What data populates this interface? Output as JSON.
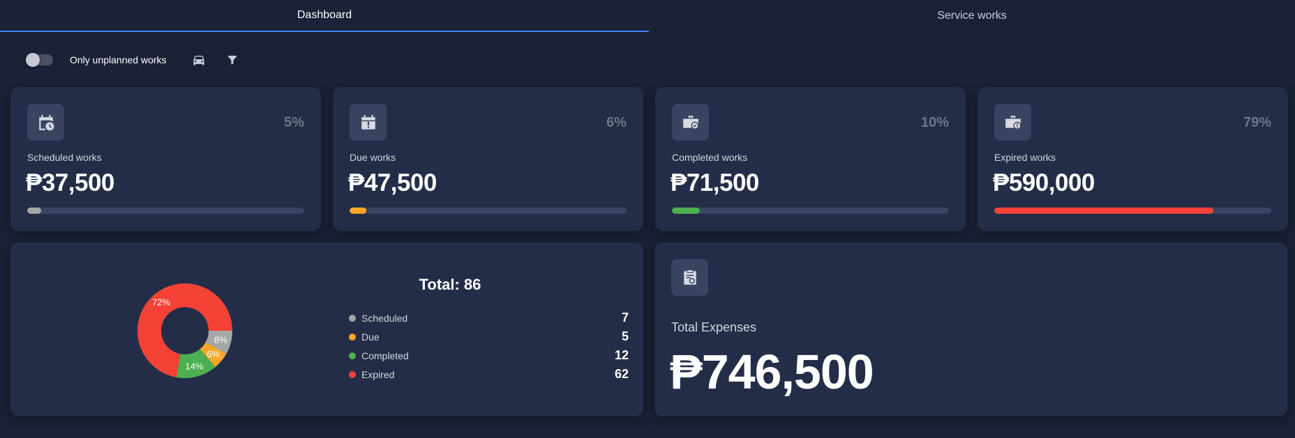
{
  "tabs": [
    {
      "label": "Dashboard",
      "active": true
    },
    {
      "label": "Service works",
      "active": false
    }
  ],
  "toolbar": {
    "toggle_label": "Only unplanned works",
    "toggle_on": false,
    "icons": [
      "car-icon",
      "filter-icon"
    ]
  },
  "colors": {
    "scheduled": "#a6a6a6",
    "due": "#ffa726",
    "completed": "#4caf50",
    "expired": "#f44336",
    "accent": "#3b82f6"
  },
  "stats": [
    {
      "label": "Scheduled works",
      "percent": "5%",
      "value": "₱37,500",
      "progress": 0.05,
      "icon": "calendar-clock-icon"
    },
    {
      "label": "Due works",
      "percent": "6%",
      "value": "₱47,500",
      "progress": 0.06,
      "icon": "calendar-alert-icon"
    },
    {
      "label": "Completed works",
      "percent": "10%",
      "value": "₱71,500",
      "progress": 0.1,
      "icon": "briefcase-check-icon"
    },
    {
      "label": "Expired works",
      "percent": "79%",
      "value": "₱590,000",
      "progress": 0.79,
      "icon": "briefcase-alert-icon"
    }
  ],
  "chart": {
    "total_label": "Total: 86"
  },
  "chart_data": {
    "type": "pie",
    "categories": [
      "Scheduled",
      "Due",
      "Completed",
      "Expired"
    ],
    "values": [
      7,
      5,
      12,
      62
    ],
    "slice_labels": [
      "8%",
      "6%",
      "14%",
      "72%"
    ],
    "colors": [
      "#a6a6a6",
      "#ffa726",
      "#4caf50",
      "#f44336"
    ]
  },
  "legend": [
    {
      "name": "Scheduled",
      "count": "7"
    },
    {
      "name": "Due",
      "count": "5"
    },
    {
      "name": "Completed",
      "count": "12"
    },
    {
      "name": "Expired",
      "count": "62"
    }
  ],
  "expenses": {
    "label": "Total Expenses",
    "value": "₱746,500",
    "icon": "receipt-icon"
  }
}
